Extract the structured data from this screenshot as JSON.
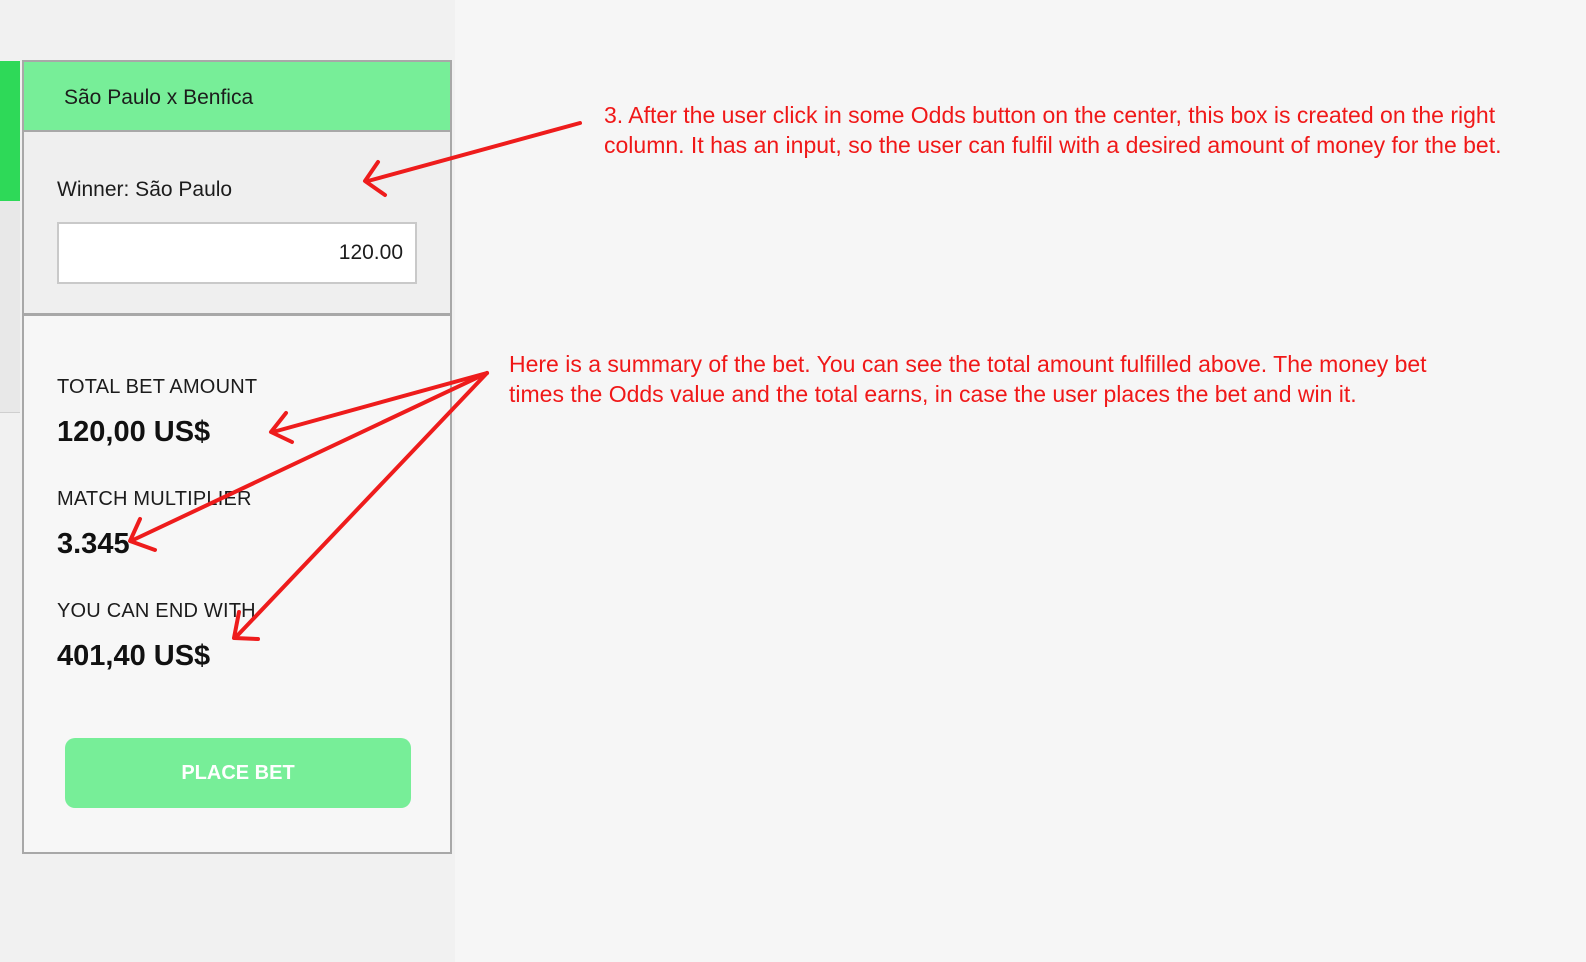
{
  "bet_slip": {
    "match_title": "São Paulo x Benfica",
    "selection_label": "Winner: São Paulo",
    "amount_value": "120.00",
    "summary": {
      "total_bet_label": "TOTAL BET AMOUNT",
      "total_bet_value": "120,00 US$",
      "multiplier_label": "MATCH MULTIPLIER",
      "multiplier_value": "3.345",
      "end_with_label": "YOU CAN END WITH",
      "end_with_value": "401,40 US$"
    },
    "place_bet_label": "PLACE BET"
  },
  "annotations": {
    "note_1": "3. After the user click in some Odds button on the center, this box is created on the right column. It has an input, so the user can fulfil with a desired amount of money for the bet.",
    "note_2": "Here is a summary of the bet. You can see the total amount fulfilled above. The money bet times the Odds value and the total earns, in case the user places the bet and win it."
  },
  "colors": {
    "accent_green": "#77ee98",
    "left_accent_green": "#2ed958",
    "annotation_red": "#f01818"
  }
}
